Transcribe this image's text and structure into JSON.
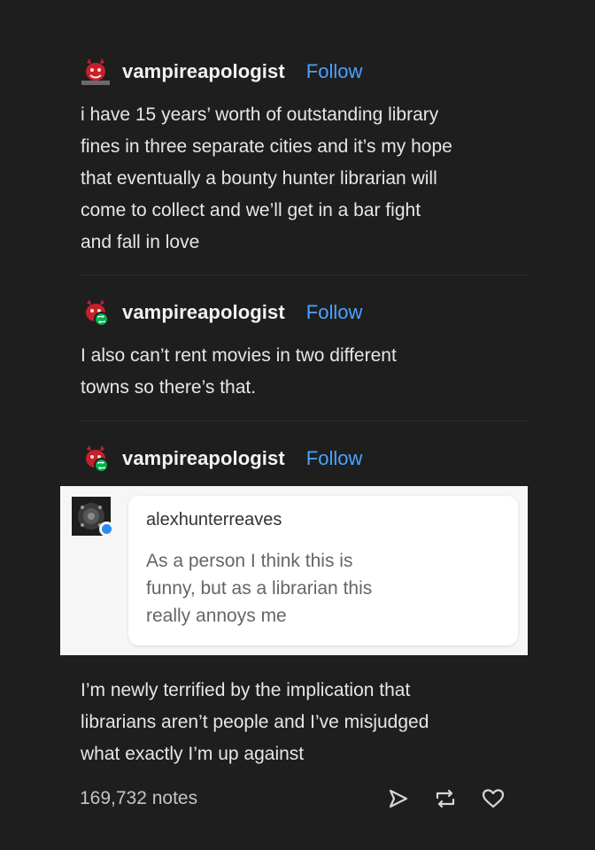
{
  "post": {
    "original": {
      "username": "vampireapologist",
      "follow_label": "Follow",
      "lines": [
        "i have 15 years’ worth of outstanding library",
        "fines in three separate cities and it’s my hope",
        "that eventually a bounty hunter librarian will",
        "come to collect and we’ll get in a bar fight",
        "and fall in love"
      ]
    },
    "reblog1": {
      "username": "vampireapologist",
      "follow_label": "Follow",
      "lines": [
        "I also can’t rent movies in two different",
        "towns so there’s that."
      ]
    },
    "reblog2": {
      "username": "vampireapologist",
      "follow_label": "Follow",
      "ask": {
        "asker": "alexhunterreaves",
        "lines": [
          "As a person I think this is",
          "funny, but as a librarian this",
          "really annoys me"
        ]
      },
      "lines": [
        "I’m newly terrified by the implication that",
        "librarians aren’t people and I’ve misjudged",
        "what exactly I’m up against"
      ]
    },
    "footer": {
      "notes": "169,732 notes",
      "icons": [
        "share-icon",
        "reblog-icon",
        "like-icon"
      ]
    }
  },
  "colors": {
    "background": "#1e1e1f",
    "follow": "#4aa3ff",
    "reblog_badge": "#00b050",
    "ask_badge": "#2b8cf0",
    "avatar_red": "#c8202a"
  }
}
